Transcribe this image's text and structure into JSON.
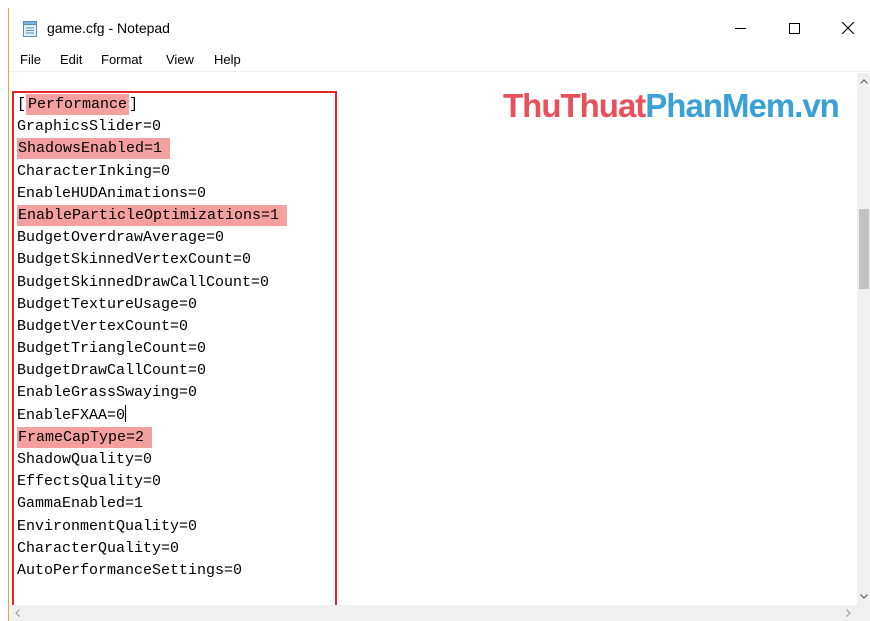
{
  "window": {
    "title": "game.cfg - Notepad"
  },
  "icons": {
    "app": "notepad-icon",
    "minimize": "minimize-icon",
    "maximize": "maximize-icon",
    "close": "close-icon"
  },
  "menu": {
    "items": [
      "File",
      "Edit",
      "Format",
      "View",
      "Help"
    ]
  },
  "watermark": {
    "part1": "ThuThuat",
    "part2": "PhanMem.vn"
  },
  "colors": {
    "highlight": "#f4a0a0",
    "box_border": "#e8262a",
    "watermark_red": "#e8505a",
    "watermark_blue": "#3aa0d8"
  },
  "editor": {
    "lines": [
      {
        "pre": "[",
        "hl": "Performance",
        "post": "]"
      },
      {
        "pre": "GraphicsSlider=0"
      },
      {
        "hl": "ShadowsEnabled=1"
      },
      {
        "pre": "CharacterInking=0"
      },
      {
        "pre": "EnableHUDAnimations=0"
      },
      {
        "hl": "EnableParticleOptimizations=1"
      },
      {
        "pre": "BudgetOverdrawAverage=0"
      },
      {
        "pre": "BudgetSkinnedVertexCount=0"
      },
      {
        "pre": "BudgetSkinnedDrawCallCount=0"
      },
      {
        "pre": "BudgetTextureUsage=0"
      },
      {
        "pre": "BudgetVertexCount=0"
      },
      {
        "pre": "BudgetTriangleCount=0"
      },
      {
        "pre": "BudgetDrawCallCount=0"
      },
      {
        "pre": "EnableGrassSwaying=0"
      },
      {
        "pre": "EnableFXAA=0",
        "caret": true
      },
      {
        "hl": "FrameCapType=2"
      },
      {
        "pre": "ShadowQuality=0"
      },
      {
        "pre": "EffectsQuality=0"
      },
      {
        "pre": "GammaEnabled=1"
      },
      {
        "pre": "EnvironmentQuality=0"
      },
      {
        "pre": "CharacterQuality=0"
      },
      {
        "pre": "AutoPerformanceSettings=0"
      }
    ]
  }
}
